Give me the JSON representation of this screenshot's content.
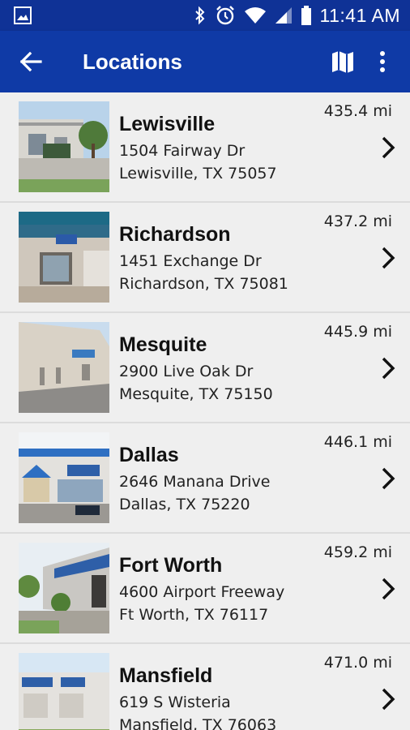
{
  "status_bar": {
    "time": "11:41 AM",
    "icons": [
      "gallery-icon",
      "bluetooth-icon",
      "alarm-icon",
      "wifi-icon",
      "cell-signal-icon",
      "battery-icon"
    ]
  },
  "app_bar": {
    "title": "Locations",
    "back_icon": "arrow-back-icon",
    "map_icon": "map-icon",
    "more_icon": "more-vert-icon",
    "color": "#0f3aa6"
  },
  "locations": [
    {
      "name": "Lewisville",
      "address1": "1504 Fairway Dr",
      "address2": "Lewisville, TX 75057",
      "distance": "435.4 mi"
    },
    {
      "name": "Richardson",
      "address1": "1451 Exchange Dr",
      "address2": "Richardson, TX 75081",
      "distance": "437.2 mi"
    },
    {
      "name": "Mesquite",
      "address1": "2900 Live Oak Dr",
      "address2": "Mesquite, TX 75150",
      "distance": "445.9 mi"
    },
    {
      "name": "Dallas",
      "address1": "2646 Manana Drive",
      "address2": "Dallas, TX 75220",
      "distance": "446.1 mi"
    },
    {
      "name": "Fort Worth",
      "address1": "4600 Airport Freeway",
      "address2": "Ft Worth, TX 76117",
      "distance": "459.2 mi"
    },
    {
      "name": "Mansfield",
      "address1": "619 S Wisteria",
      "address2": "Mansfield, TX 76063",
      "distance": "471.0 mi"
    }
  ]
}
